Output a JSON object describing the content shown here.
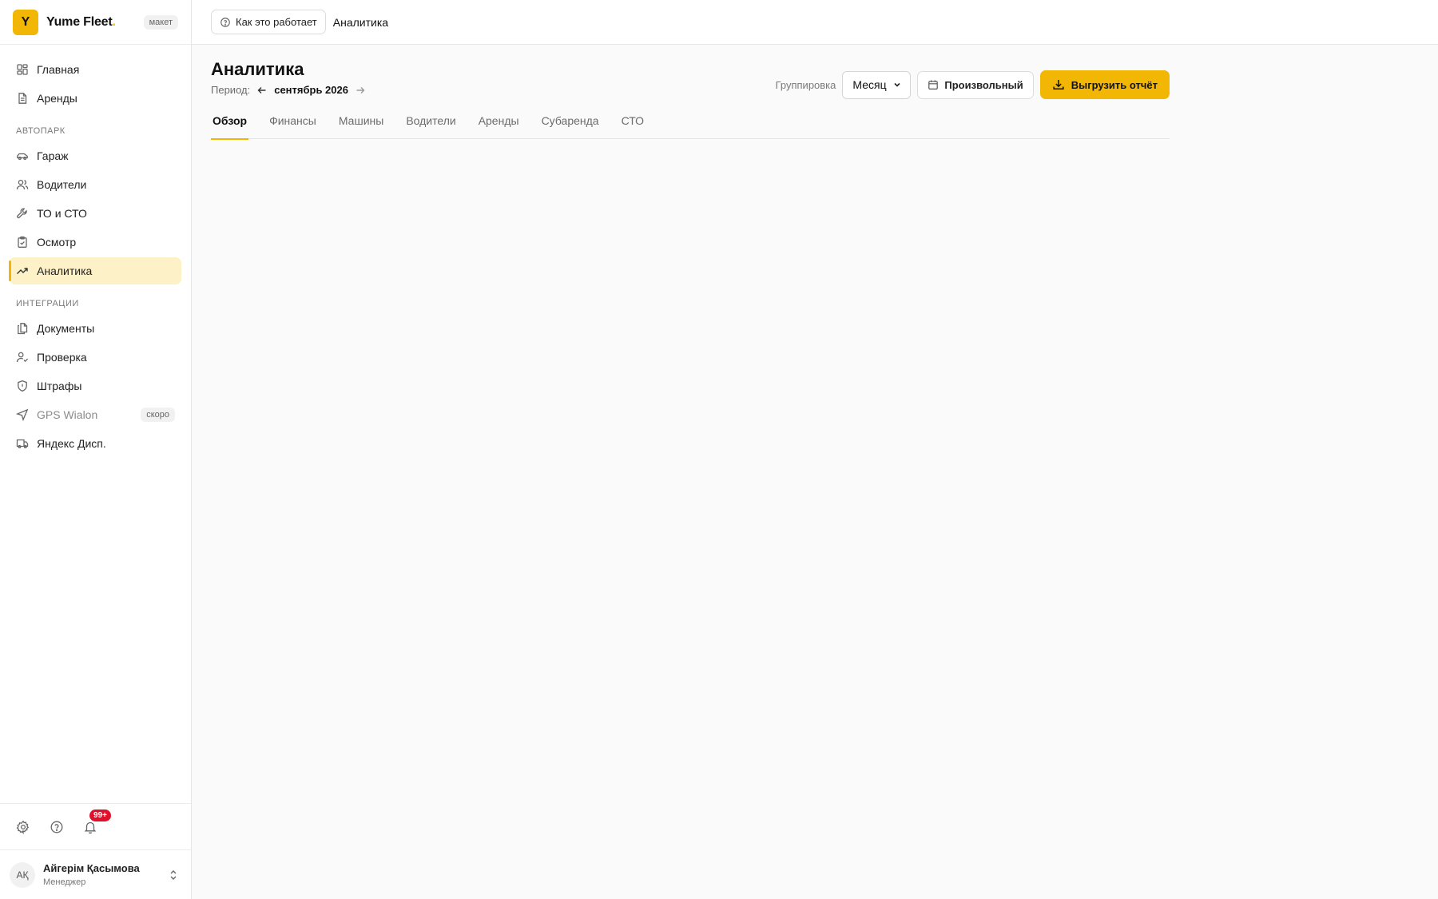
{
  "brand": {
    "logo_letter": "Y",
    "name": "Yume Fleet",
    "dot": ".",
    "badge": "макет"
  },
  "nav": {
    "top": [
      {
        "label": "Главная",
        "icon": "dashboard-icon"
      },
      {
        "label": "Аренды",
        "icon": "document-icon"
      }
    ],
    "section_fleet": "АВТОПАРК",
    "fleet": [
      {
        "label": "Гараж",
        "icon": "car-icon"
      },
      {
        "label": "Водители",
        "icon": "users-icon"
      },
      {
        "label": "ТО и СТО",
        "icon": "wrench-icon"
      },
      {
        "label": "Осмотр",
        "icon": "clipboard-check-icon"
      },
      {
        "label": "Аналитика",
        "icon": "trending-up-icon",
        "active": true
      }
    ],
    "section_integrations": "ИНТЕГРАЦИИ",
    "integrations": [
      {
        "label": "Документы",
        "icon": "files-icon"
      },
      {
        "label": "Проверка",
        "icon": "user-check-icon"
      },
      {
        "label": "Штрафы",
        "icon": "shield-icon"
      },
      {
        "label": "GPS Wialon",
        "icon": "navigation-icon",
        "badge": "скоро",
        "muted": true
      },
      {
        "label": "Яндекс Дисп.",
        "icon": "truck-icon"
      }
    ]
  },
  "footer": {
    "notifications_badge": "99+"
  },
  "user": {
    "initials": "AҚ",
    "name": "Айгерім Қасымова",
    "role": "Менеджер"
  },
  "topbar": {
    "help_button": "Как это работает",
    "breadcrumb": "Аналитика"
  },
  "page": {
    "title": "Аналитика",
    "period_label": "Период:",
    "period_value": "сентябрь 2026",
    "grouping_label": "Группировка",
    "grouping_value": "Месяц",
    "custom_button": "Произвольный",
    "export_button": "Выгрузить отчёт"
  },
  "tabs": [
    {
      "label": "Обзор",
      "active": true
    },
    {
      "label": "Финансы"
    },
    {
      "label": "Машины"
    },
    {
      "label": "Водители"
    },
    {
      "label": "Аренды"
    },
    {
      "label": "Субаренда"
    },
    {
      "label": "СТО"
    }
  ],
  "colors": {
    "accent": "#f2b705",
    "active_bg": "#fdf1c7",
    "badge_red": "#e0102a"
  }
}
